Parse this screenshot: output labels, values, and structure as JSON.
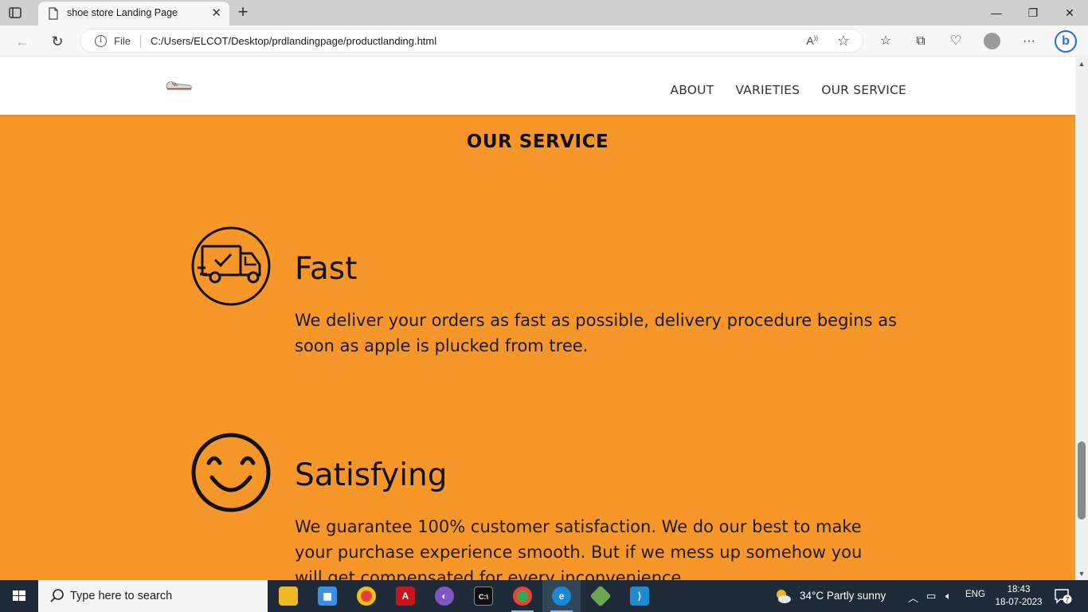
{
  "browser": {
    "tab_title": "shoe store Landing Page",
    "address_prefix": "File",
    "url": "C:/Users/ELCOT/Desktop/prdlandingpage/productlanding.html"
  },
  "site": {
    "nav": [
      "ABOUT",
      "VARIETIES",
      "OUR SERVICE"
    ],
    "section_title": "OUR SERVICE",
    "services": [
      {
        "icon": "delivery-truck-icon",
        "heading": "Fast",
        "text": "We deliver your orders as fast as possible, delivery procedure begins as soon as apple is plucked from tree."
      },
      {
        "icon": "smiley-face-icon",
        "heading": "Satisfying",
        "text": "We guarantee 100% customer satisfaction. We do our best to make your purchase experience smooth. But if we mess up somehow you will get compensated for every inconvenience."
      }
    ]
  },
  "taskbar": {
    "search_placeholder": "Type here to search",
    "weather": "34°C  Partly sunny",
    "language": "ENG",
    "time": "18:43",
    "date": "18-07-2023",
    "notification_count": "7"
  },
  "colors": {
    "page_bg": "#f7972a",
    "taskbar_bg": "#1f2b38"
  }
}
